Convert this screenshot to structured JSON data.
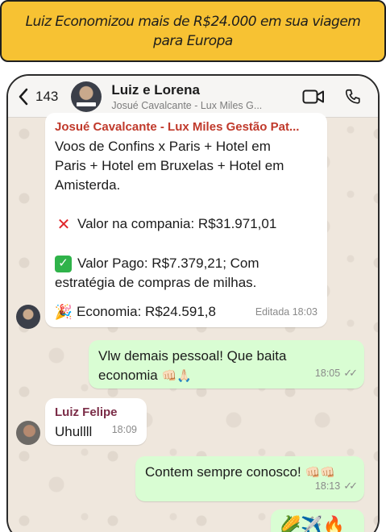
{
  "banner": {
    "text": "Luiz Economizou mais de R$24.000 em sua viagem para Europa"
  },
  "header": {
    "back_count": "143",
    "name": "Luiz e Lorena",
    "subtitle": "Josué Cavalcante - Lux Miles G...",
    "icons": [
      "video-call-icon",
      "voice-call-icon"
    ]
  },
  "messages": [
    {
      "sender": "Josué Cavalcante - Lux Miles Gestão Pat...",
      "sender_color": "#c0392b",
      "lines": [
        "Voos de Confins x Paris + Hotel em",
        "Paris + Hotel em Bruxelas + Hotel em",
        "Amisterda."
      ],
      "lost_value": "Valor na compania: R$31.971,01",
      "paid_lines": [
        "Valor Pago: R$7.379,21; Com",
        "estratégia de compras de milhas."
      ],
      "savings": "Economia: R$24.591,8",
      "time": "Editada 18:03"
    },
    {
      "lines": [
        "Vlw demais pessoal! Que baita",
        "economia"
      ],
      "emoji": "👊🏻🙏🏻",
      "time": "18:05",
      "outgoing": true
    },
    {
      "sender": "Luiz Felipe",
      "sender_color": "#7b2c47",
      "lines": [
        "Uhullll"
      ],
      "time": "18:09"
    },
    {
      "lines": [
        "Contem sempre conosco!"
      ],
      "emoji": "👊🏻👊🏻",
      "time": "18:13",
      "outgoing": true
    },
    {
      "emoji": "🌽✈️🔥",
      "outgoing": true
    }
  ],
  "colors": {
    "banner": "#f7c233",
    "outgoing_bubble": "#d9fdd3",
    "chat_bg": "#efe7dd"
  }
}
